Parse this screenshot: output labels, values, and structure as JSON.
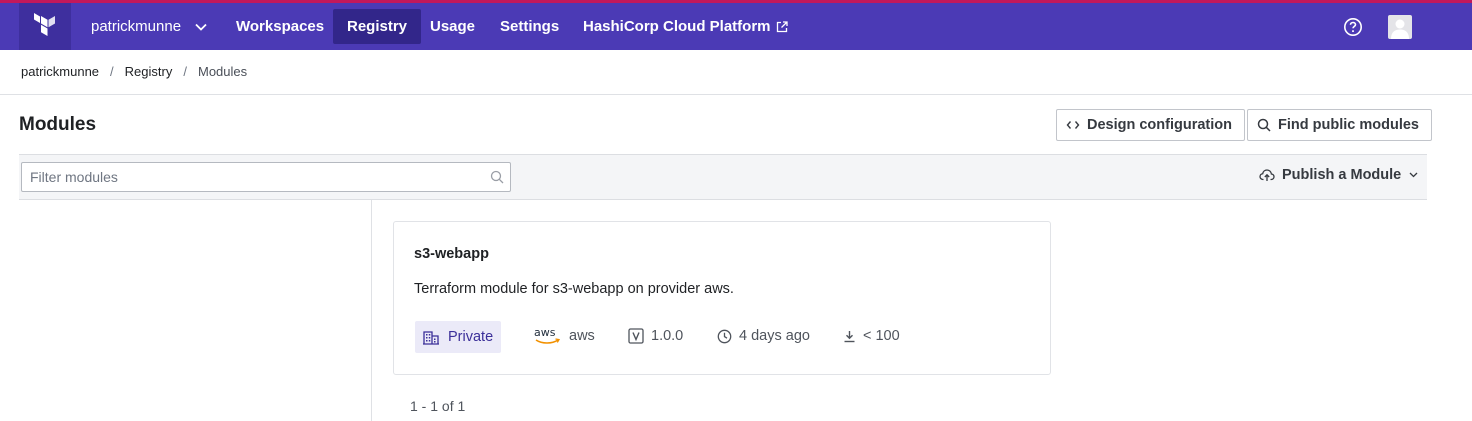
{
  "header": {
    "org_name": "patrickmunne",
    "nav": [
      {
        "label": "Workspaces",
        "active": false
      },
      {
        "label": "Registry",
        "active": true
      },
      {
        "label": "Usage",
        "active": false
      },
      {
        "label": "Settings",
        "active": false
      },
      {
        "label": "HashiCorp Cloud Platform",
        "active": false,
        "external": true
      }
    ],
    "icons": [
      "terraform-logo",
      "chevron-down-icon",
      "external-link-icon",
      "help-icon",
      "avatar"
    ]
  },
  "breadcrumb": {
    "items": [
      "patrickmunne",
      "Registry",
      "Modules"
    ],
    "separator": "/"
  },
  "page": {
    "title": "Modules",
    "design_button_label": "Design configuration",
    "find_button_label": "Find public modules"
  },
  "toolbar": {
    "filter_placeholder": "Filter modules",
    "filter_value": "",
    "publish_label": "Publish a Module"
  },
  "modules": [
    {
      "name": "s3-webapp",
      "description": "Terraform module for s3-webapp on provider aws.",
      "visibility": "Private",
      "provider_logo": "aws",
      "provider": "aws",
      "version": "1.0.0",
      "published": "4 days ago",
      "downloads": "< 100"
    }
  ],
  "pagination": {
    "text": "1 - 1 of 1"
  },
  "colors": {
    "topline": "#c2185b",
    "navbar": "#4b3ab5",
    "nav_active": "#32268a",
    "badge_bg": "#ebeaf8",
    "badge_text": "#3b2f99",
    "aws_smile": "#f29100"
  }
}
